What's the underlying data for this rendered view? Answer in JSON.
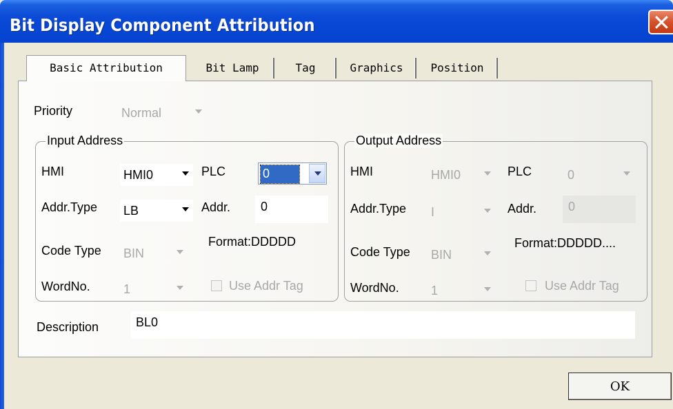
{
  "window": {
    "title": "Bit Display Component Attribution",
    "close_symbol": "✕"
  },
  "tabs": [
    {
      "label": "Basic Attribution",
      "active": true
    },
    {
      "label": "Bit Lamp",
      "active": false
    },
    {
      "label": "Tag",
      "active": false
    },
    {
      "label": "Graphics",
      "active": false
    },
    {
      "label": "Position",
      "active": false
    }
  ],
  "priority": {
    "label": "Priority",
    "value": "Normal"
  },
  "input_address": {
    "title": "Input Address",
    "hmi_label": "HMI",
    "hmi_value": "HMI0",
    "plc_label": "PLC",
    "plc_value": "0",
    "addr_type_label": "Addr.Type",
    "addr_type_value": "LB",
    "addr_label": "Addr.",
    "addr_value": "0",
    "format": "Format:DDDDD",
    "code_type_label": "Code Type",
    "code_type_value": "BIN",
    "word_no_label": "WordNo.",
    "word_no_value": "1",
    "use_addr_tag_label": "Use Addr Tag"
  },
  "output_address": {
    "title": "Output Address",
    "hmi_label": "HMI",
    "hmi_value": "HMI0",
    "plc_label": "PLC",
    "plc_value": "0",
    "addr_type_label": "Addr.Type",
    "addr_type_value": "I",
    "addr_label": "Addr.",
    "addr_value": "0",
    "format": "Format:DDDDD....",
    "code_type_label": "Code Type",
    "code_type_value": "BIN",
    "word_no_label": "WordNo.",
    "word_no_value": "1",
    "use_addr_tag_label": "Use Addr Tag"
  },
  "description": {
    "label": "Description",
    "value": "BL0"
  },
  "buttons": {
    "ok_label": "OK"
  },
  "colors": {
    "title_bar": "#0543d0",
    "close_button": "#d5512b",
    "selection": "#316ac5"
  }
}
